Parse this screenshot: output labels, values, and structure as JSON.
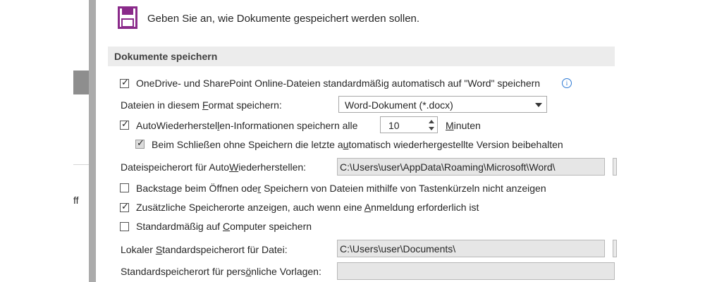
{
  "left_nav": {
    "partial_label": "ff"
  },
  "header": {
    "icon": "floppy-disk-icon",
    "icon_color": "#8a2a8a",
    "text": "Geben Sie an, wie Dokumente gespeichert werden sollen."
  },
  "section": {
    "title": "Dokumente speichern"
  },
  "options": {
    "onedrive": {
      "label": "OneDrive- und SharePoint Online-Dateien standardmäßig automatisch auf \"Word\" speichern",
      "checked": true,
      "info_icon": "info-icon"
    },
    "format": {
      "label_pre": "Dateien in diesem ",
      "label_u": "F",
      "label_post": "ormat speichern:",
      "value": "Word-Dokument (*.docx)"
    },
    "autorecover": {
      "label_pre": "AutoWiederherstel",
      "label_u": "l",
      "label_post": "en-Informationen speichern alle",
      "checked": true,
      "minutes_value": "10",
      "unit_u": "M",
      "unit_post": "inuten"
    },
    "keep_last": {
      "label_pre": "Beim Schließen ohne Speichern die letzte a",
      "label_u": "u",
      "label_post": "tomatisch wiederhergestellte Version beibehalten",
      "checked": true
    },
    "autorecover_path": {
      "label_pre": "Dateispeicherort für Auto",
      "label_u": "W",
      "label_post": "iederherstellen:",
      "value": "C:\\Users\\user\\AppData\\Roaming\\Microsoft\\Word\\"
    },
    "backstage": {
      "label_pre": "Backstage beim Öffnen ode",
      "label_u": "r",
      "label_post": " Speichern von Dateien mithilfe von Tastenkürzeln nicht anzeigen",
      "checked": false
    },
    "extra_locations": {
      "label_pre": "Zusätzliche Speicherorte anzeigen, auch wenn eine ",
      "label_u": "A",
      "label_post": "nmeldung erforderlich ist",
      "checked": true
    },
    "computer_default": {
      "label_pre": "Standardmäßig auf ",
      "label_u": "C",
      "label_post": "omputer speichern",
      "checked": false
    },
    "local_path": {
      "label_pre": "Lokaler ",
      "label_u": "S",
      "label_post": "tandardspeicherort für Datei:",
      "value": "C:\\Users\\user\\Documents\\"
    },
    "templates_path": {
      "label_pre": "Standardspeicherort für pers",
      "label_u": "ö",
      "label_post": "nliche Vorlagen:",
      "value": ""
    }
  }
}
